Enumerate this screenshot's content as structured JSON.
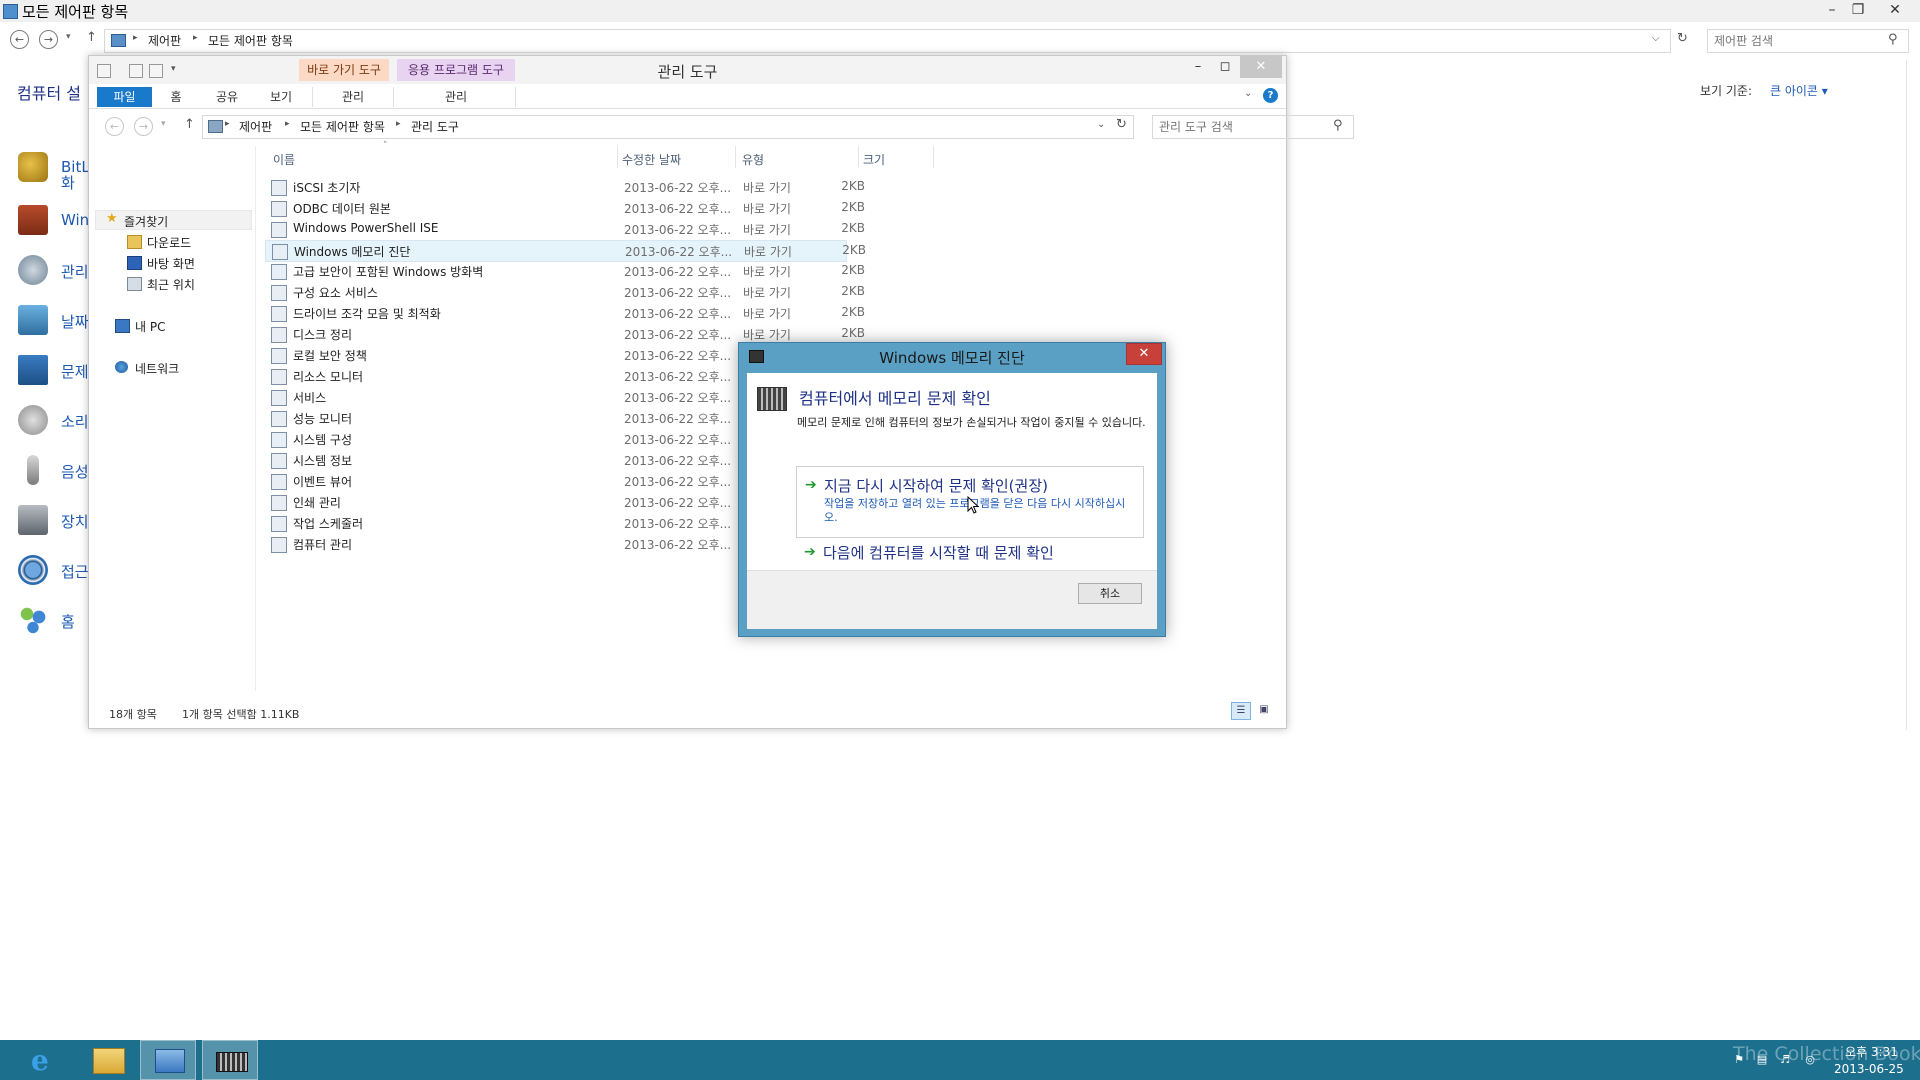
{
  "background_window": {
    "title": "모든 제어판 항목",
    "breadcrumb": [
      "제어판",
      "모든 제어판 항목"
    ],
    "search_placeholder": "제어판 검색",
    "heading": "컴퓨터 설",
    "view_by_label": "보기 기준:",
    "view_by_value": "큰 아이콘 ▾",
    "items": [
      {
        "label": "BitL",
        "icon": "bitlocker-icon"
      },
      {
        "label": "Win",
        "icon": "windows-firewall-icon"
      },
      {
        "label": "관리",
        "icon": "admin-tools-icon"
      },
      {
        "label": "날짜",
        "icon": "date-time-icon"
      },
      {
        "label": "문제",
        "icon": "troubleshoot-icon"
      },
      {
        "label": "소리",
        "icon": "sound-icon"
      },
      {
        "label": "음성",
        "icon": "speech-icon"
      },
      {
        "label": "장치",
        "icon": "devices-icon"
      },
      {
        "label": "접근",
        "icon": "ease-of-access-icon"
      },
      {
        "label": "홈",
        "icon": "homegroup-icon"
      }
    ],
    "item_extra": "화"
  },
  "explorer": {
    "title": "관리 도구",
    "context_tabs": [
      {
        "group": "바로 가기 도구",
        "tab": "관리"
      },
      {
        "group": "응용 프로그램 도구",
        "tab": "관리"
      }
    ],
    "ribbon_tabs": [
      "파일",
      "홈",
      "공유",
      "보기"
    ],
    "breadcrumb": [
      "제어판",
      "모든 제어판 항목",
      "관리 도구"
    ],
    "search_placeholder": "관리 도구 검색",
    "sidebar": {
      "favorites": "즐겨찾기",
      "favorite_items": [
        "다운로드",
        "바탕 화면",
        "최근 위치"
      ],
      "this_pc": "내 PC",
      "network": "네트워크"
    },
    "columns": {
      "name": "이름",
      "date": "수정한 날짜",
      "type": "유형",
      "size": "크기"
    },
    "files": [
      {
        "name": "iSCSI 초기자",
        "date": "2013-06-22 오후...",
        "type": "바로 가기",
        "size": "2KB"
      },
      {
        "name": "ODBC 데이터 원본",
        "date": "2013-06-22 오후...",
        "type": "바로 가기",
        "size": "2KB"
      },
      {
        "name": "Windows PowerShell ISE",
        "date": "2013-06-22 오후...",
        "type": "바로 가기",
        "size": "2KB"
      },
      {
        "name": "Windows 메모리 진단",
        "date": "2013-06-22 오후...",
        "type": "바로 가기",
        "size": "2KB"
      },
      {
        "name": "고급 보안이 포함된 Windows 방화벽",
        "date": "2013-06-22 오후...",
        "type": "바로 가기",
        "size": "2KB"
      },
      {
        "name": "구성 요소 서비스",
        "date": "2013-06-22 오후...",
        "type": "바로 가기",
        "size": "2KB"
      },
      {
        "name": "드라이브 조각 모음 및 최적화",
        "date": "2013-06-22 오후...",
        "type": "바로 가기",
        "size": "2KB"
      },
      {
        "name": "디스크 정리",
        "date": "2013-06-22 오후...",
        "type": "바로 가기",
        "size": "2KB"
      },
      {
        "name": "로컬 보안 정책",
        "date": "2013-06-22 오후...",
        "type": "바로 가기",
        "size": ""
      },
      {
        "name": "리소스 모니터",
        "date": "2013-06-22 오후...",
        "type": "바로 가기",
        "size": ""
      },
      {
        "name": "서비스",
        "date": "2013-06-22 오후...",
        "type": "바로 가기",
        "size": ""
      },
      {
        "name": "성능 모니터",
        "date": "2013-06-22 오후...",
        "type": "바로 가기",
        "size": ""
      },
      {
        "name": "시스템 구성",
        "date": "2013-06-22 오후...",
        "type": "바로 가기",
        "size": ""
      },
      {
        "name": "시스템 정보",
        "date": "2013-06-22 오후...",
        "type": "바로 가기",
        "size": ""
      },
      {
        "name": "이벤트 뷰어",
        "date": "2013-06-22 오후...",
        "type": "바로 가기",
        "size": ""
      },
      {
        "name": "인쇄 관리",
        "date": "2013-06-22 오후...",
        "type": "바로 가기",
        "size": ""
      },
      {
        "name": "작업 스케줄러",
        "date": "2013-06-22 오후...",
        "type": "바로 가기",
        "size": ""
      },
      {
        "name": "컴퓨터 관리",
        "date": "2013-06-22 오후...",
        "type": "바로 가기",
        "size": ""
      }
    ],
    "selected_index": 3,
    "status": {
      "count": "18개 항목",
      "selection": "1개 항목 선택함 1.11KB"
    }
  },
  "dialog": {
    "title": "Windows 메모리 진단",
    "heading": "컴퓨터에서 메모리 문제 확인",
    "description": "메모리 문제로 인해 컴퓨터의 정보가 손실되거나 작업이 중지될 수 있습니다.",
    "option1_title": "지금 다시 시작하여 문제 확인(권장)",
    "option1_sub": "작업을 저장하고 열려 있는 프로그램을 닫은 다음 다시 시작하십시오.",
    "option2_title": "다음에 컴퓨터를 시작할 때 문제 확인",
    "cancel": "취소"
  },
  "taskbar": {
    "time": "오후 3:31",
    "date": "2013-06-25",
    "watermark": "The Collection Book"
  }
}
